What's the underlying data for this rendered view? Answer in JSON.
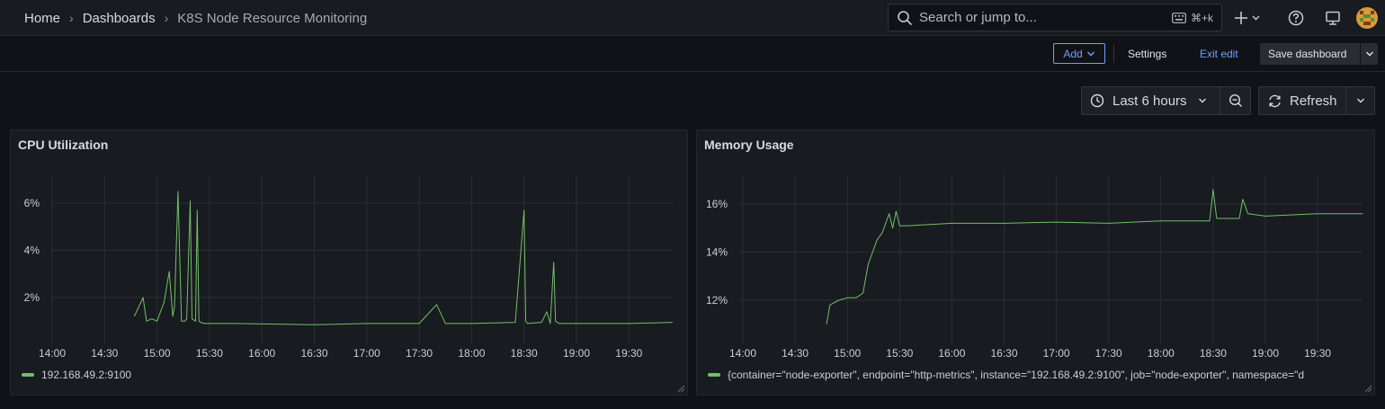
{
  "breadcrumb": {
    "home": "Home",
    "dashboards": "Dashboards",
    "current": "K8S Node Resource Monitoring"
  },
  "search": {
    "placeholder": "Search or jump to...",
    "shortcut": "⌘+k"
  },
  "toolbar": {
    "add_label": "Add",
    "settings_label": "Settings",
    "exit_edit_label": "Exit edit",
    "save_label": "Save dashboard"
  },
  "time_picker": {
    "range_label": "Last 6 hours",
    "refresh_label": "Refresh"
  },
  "colors": {
    "series": "#73bf69",
    "accent": "#6e9fff",
    "background": "#111217",
    "panel": "#181b1f"
  },
  "panels": [
    {
      "title": "CPU Utilization",
      "legend": "192.168.49.2:9100",
      "chart_data": {
        "type": "line",
        "title": "CPU Utilization",
        "x_ticks": [
          "14:00",
          "14:30",
          "15:00",
          "15:30",
          "16:00",
          "16:30",
          "17:00",
          "17:30",
          "18:00",
          "18:30",
          "19:00",
          "19:30"
        ],
        "y_ticks": [
          "2%",
          "4%",
          "6%"
        ],
        "ylim": [
          0.1,
          7.3
        ],
        "grid": true,
        "legend_position": "bottom-left",
        "series": [
          {
            "name": "192.168.49.2:9100",
            "x": [
              "14:47",
              "14:52",
              "14:54",
              "14:57",
              "15:00",
              "15:04",
              "15:07",
              "15:09",
              "15:10",
              "15:12",
              "15:14",
              "15:16",
              "15:17",
              "15:19",
              "15:20",
              "15:22",
              "15:23",
              "15:24",
              "15:25",
              "15:27",
              "15:30",
              "15:45",
              "16:30",
              "17:00",
              "17:30",
              "17:40",
              "17:45",
              "18:00",
              "18:25",
              "18:30",
              "18:31",
              "18:32",
              "18:40",
              "18:43",
              "18:45",
              "18:47",
              "18:48",
              "18:50",
              "19:00",
              "19:30",
              "19:55"
            ],
            "values": [
              1.2,
              2.0,
              1.0,
              1.1,
              1.0,
              1.8,
              3.1,
              1.2,
              1.6,
              6.5,
              1.0,
              1.0,
              1.1,
              6.1,
              1.1,
              1.0,
              5.7,
              1.0,
              0.95,
              0.9,
              0.9,
              0.9,
              0.85,
              0.9,
              0.9,
              1.7,
              0.9,
              0.9,
              0.95,
              5.7,
              1.0,
              0.9,
              0.95,
              1.4,
              0.9,
              3.5,
              1.0,
              0.9,
              0.9,
              0.9,
              0.95
            ]
          }
        ]
      }
    },
    {
      "title": "Memory Usage",
      "legend": "{container=\"node-exporter\", endpoint=\"http-metrics\", instance=\"192.168.49.2:9100\", job=\"node-exporter\", namespace=\"d",
      "chart_data": {
        "type": "line",
        "title": "Memory Usage",
        "x_ticks": [
          "14:00",
          "14:30",
          "15:00",
          "15:30",
          "16:00",
          "16:30",
          "17:00",
          "17:30",
          "18:00",
          "18:30",
          "19:00",
          "19:30"
        ],
        "y_ticks": [
          "12%",
          "14%",
          "16%"
        ],
        "ylim": [
          10.3,
          17.3
        ],
        "grid": true,
        "legend_position": "bottom-left",
        "series": [
          {
            "name": "{container=\"node-exporter\", endpoint=\"http-metrics\", instance=\"192.168.49.2:9100\", job=\"node-exporter\", namespace=\"d",
            "x": [
              "14:48",
              "14:50",
              "14:55",
              "15:00",
              "15:05",
              "15:09",
              "15:12",
              "15:14",
              "15:17",
              "15:20",
              "15:24",
              "15:26",
              "15:28",
              "15:30",
              "15:35",
              "16:00",
              "16:30",
              "17:00",
              "17:30",
              "18:00",
              "18:28",
              "18:30",
              "18:32",
              "18:45",
              "18:47",
              "18:50",
              "19:00",
              "19:30",
              "19:56"
            ],
            "values": [
              11.0,
              11.8,
              12.0,
              12.1,
              12.1,
              12.3,
              13.5,
              13.9,
              14.5,
              14.8,
              15.6,
              15.0,
              15.7,
              15.1,
              15.1,
              15.2,
              15.2,
              15.25,
              15.2,
              15.3,
              15.3,
              16.6,
              15.4,
              15.4,
              16.2,
              15.6,
              15.5,
              15.6,
              15.6
            ]
          }
        ]
      }
    }
  ]
}
